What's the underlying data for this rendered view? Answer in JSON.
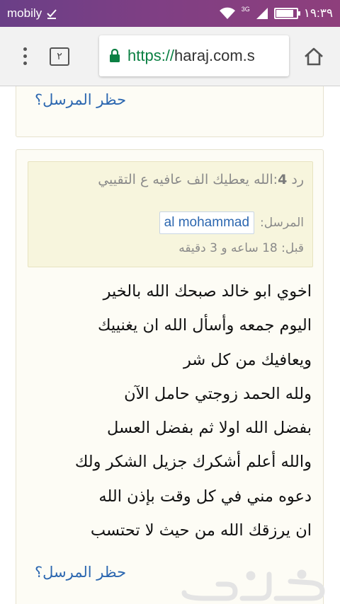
{
  "status_bar": {
    "carrier": "mobily",
    "network": "3G",
    "time": "١٩:٣٩",
    "battery_level": 0.85
  },
  "browser": {
    "tab_count": "٢",
    "url_scheme": "https://",
    "url_host": "haraj.com.s"
  },
  "top_card": {
    "block_sender_link": "حظر المرسل؟"
  },
  "reply": {
    "number_label": "رد",
    "number": "4",
    "title": ":الله يعطيك الف عافيه ع التقييي",
    "sender_label": "المرسل:",
    "sender_name": "al mohammad",
    "since_label": "قبل:",
    "since_value": "18 ساعه و 3 دقيقه",
    "body_lines": [
      "اخوي ابو خالد صبحك الله بالخير",
      "اليوم جمعه وأسأل الله ان يغنييك",
      "ويعافيك من كل شر",
      "ولله الحمد زوجتي حامل الآن",
      "بفضل الله اولا ثم بفضل العسل",
      "والله أعلم أشكرك جزيل الشكر ولك",
      "دعوه مني في كل وقت بإذن الله",
      "ان يرزقك الله من حيث لا تحتسب"
    ],
    "block_sender_link": "حظر المرسل؟"
  },
  "watermark_text": "حراج",
  "colors": {
    "status_bar": "#7a3f86",
    "link": "#2c67b0",
    "secure_green": "#0b8043",
    "card_bg": "#fdfcf5",
    "reply_header_bg": "#f7f5dd"
  }
}
